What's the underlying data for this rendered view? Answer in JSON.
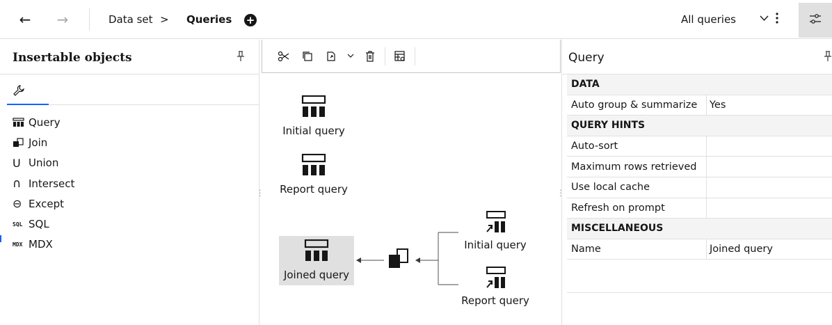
{
  "topbar": {
    "breadcrumb_parent": "Data set",
    "breadcrumb_sep": ">",
    "breadcrumb_current": "Queries",
    "filter_label": "All queries",
    "nav_back": "←",
    "nav_forward": "→"
  },
  "left_panel": {
    "title": "Insertable objects",
    "items": [
      {
        "label": "Query",
        "icon": "query-icon"
      },
      {
        "label": "Join",
        "icon": "join-icon"
      },
      {
        "label": "Union",
        "icon": "union-icon",
        "glyph": "U"
      },
      {
        "label": "Intersect",
        "icon": "intersect-icon",
        "glyph": "∩"
      },
      {
        "label": "Except",
        "icon": "except-icon",
        "glyph": "⊖"
      },
      {
        "label": "SQL",
        "icon": "sql-icon",
        "glyph": "SQL"
      },
      {
        "label": "MDX",
        "icon": "mdx-icon",
        "glyph": "MDX"
      }
    ]
  },
  "canvas": {
    "nodes": {
      "initial_query": "Initial query",
      "report_query": "Report query",
      "joined_query": "Joined query",
      "join_initial_query": "Initial query",
      "join_report_query": "Report query"
    }
  },
  "right_panel": {
    "title": "Query",
    "sections": [
      {
        "header": "DATA",
        "rows": [
          {
            "key": "Auto group & summarize",
            "value": "Yes"
          }
        ]
      },
      {
        "header": "QUERY HINTS",
        "rows": [
          {
            "key": "Auto-sort",
            "value": ""
          },
          {
            "key": "Maximum rows retrieved",
            "value": ""
          },
          {
            "key": "Use local cache",
            "value": ""
          },
          {
            "key": "Refresh on prompt",
            "value": ""
          }
        ]
      },
      {
        "header": "MISCELLANEOUS",
        "rows": [
          {
            "key": "Name",
            "value": "Joined query"
          }
        ]
      }
    ]
  },
  "colors": {
    "accent": "#0f62fe",
    "selected_bg": "#e0e0e0",
    "header_bg": "#f4f4f4"
  }
}
